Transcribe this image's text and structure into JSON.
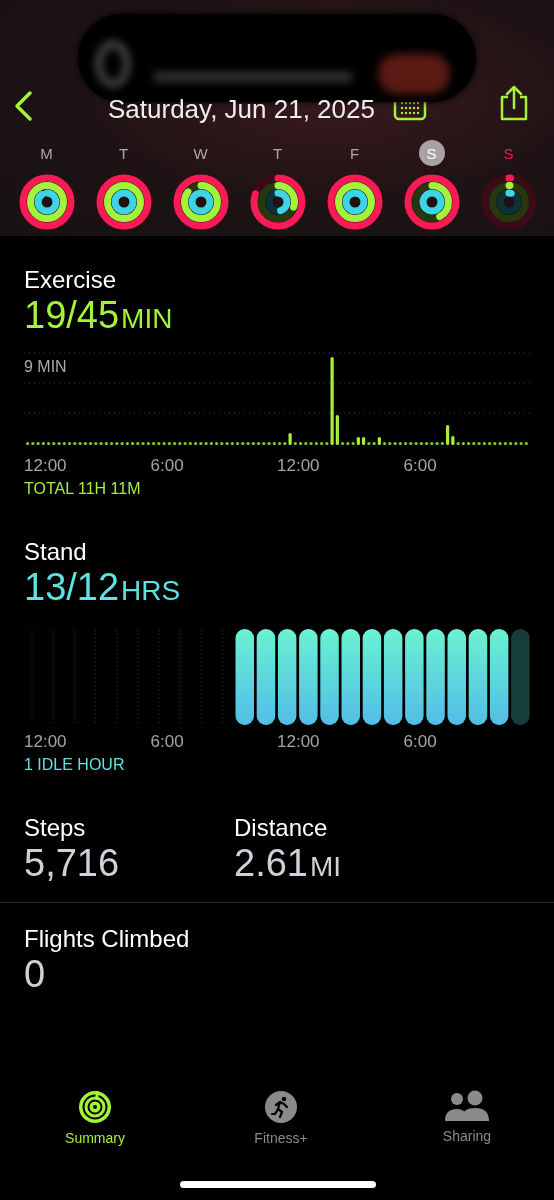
{
  "header": {
    "date": "Saturday, Jun 21, 2025"
  },
  "days": [
    {
      "letter": "M",
      "selected": false,
      "today": false,
      "move": {
        "level": 1
      },
      "exercise": {
        "level": 1
      },
      "stand": {
        "level": 0.9
      }
    },
    {
      "letter": "T",
      "selected": false,
      "today": false,
      "move": {
        "level": 1
      },
      "exercise": {
        "level": 1
      },
      "stand": {
        "level": 1
      }
    },
    {
      "letter": "W",
      "selected": false,
      "today": false,
      "move": {
        "level": 1
      },
      "exercise": {
        "level": 0.85
      },
      "stand": {
        "level": 1
      }
    },
    {
      "letter": "T",
      "selected": false,
      "today": false,
      "move": {
        "level": 0.8
      },
      "exercise": {
        "level": 0.3
      },
      "stand": {
        "level": 0.45
      }
    },
    {
      "letter": "F",
      "selected": false,
      "today": false,
      "move": {
        "level": 1
      },
      "exercise": {
        "level": 1
      },
      "stand": {
        "level": 1
      }
    },
    {
      "letter": "S",
      "selected": true,
      "today": false,
      "move": {
        "level": 1
      },
      "exercise": {
        "level": 0.42
      },
      "stand": {
        "level": 1
      }
    },
    {
      "letter": "S",
      "selected": false,
      "today": true,
      "move": {
        "level": 0.01
      },
      "exercise": {
        "level": 0.01
      },
      "stand": {
        "level": 0.04
      }
    }
  ],
  "exercise": {
    "title": "Exercise",
    "value": "19/45",
    "unit": "MIN",
    "max_label": "9 MIN",
    "x_labels": [
      "12:00",
      "6:00",
      "12:00",
      "6:00"
    ],
    "total": "TOTAL 11H 11M"
  },
  "stand": {
    "title": "Stand",
    "value": "13/12",
    "unit": "HRS",
    "x_labels": [
      "12:00",
      "6:00",
      "12:00",
      "6:00"
    ],
    "idle": "1 IDLE HOUR"
  },
  "stats": [
    {
      "title": "Steps",
      "value": "5,716"
    },
    {
      "title": "Distance",
      "value": "2.61",
      "unit": "MI"
    }
  ],
  "flights": {
    "title": "Flights Climbed",
    "value": "0"
  },
  "tabs": [
    {
      "label": "Summary",
      "kind": "summary",
      "selected": true
    },
    {
      "label": "Fitness+",
      "kind": "fitness",
      "selected": false
    },
    {
      "label": "Sharing",
      "kind": "sharing",
      "selected": false
    }
  ]
}
